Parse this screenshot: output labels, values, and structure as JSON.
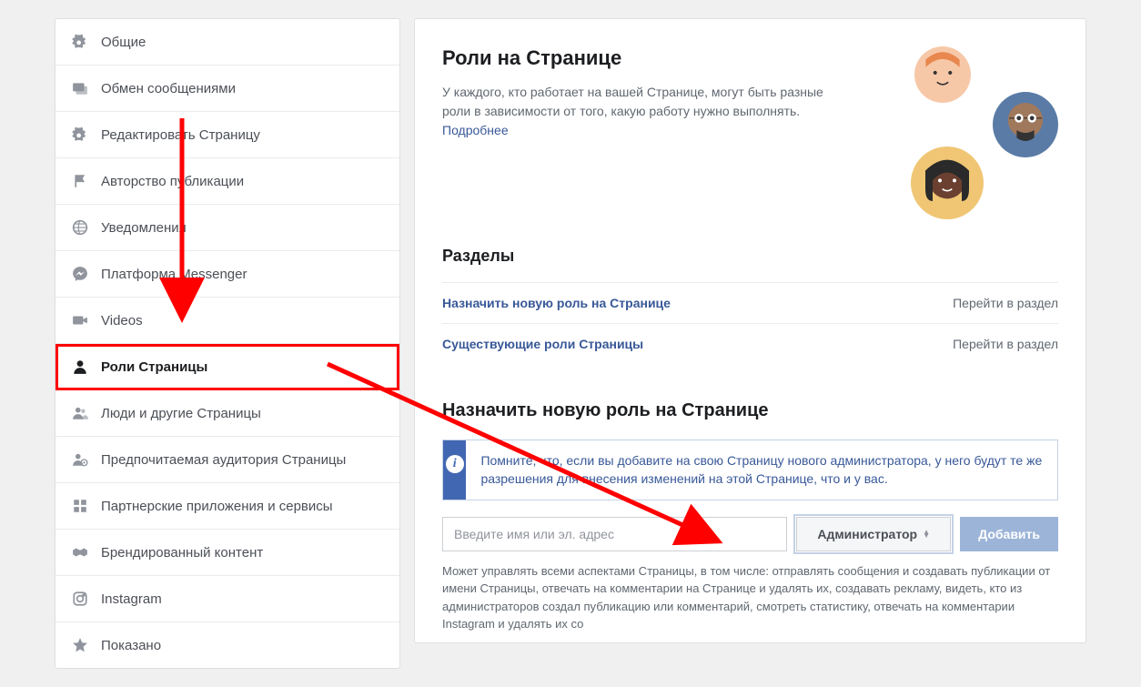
{
  "sidebar": {
    "items": [
      {
        "label": "Общие",
        "icon": "gear"
      },
      {
        "label": "Обмен сообщениями",
        "icon": "messages"
      },
      {
        "label": "Редактировать Страницу",
        "icon": "gear"
      },
      {
        "label": "Авторство публикации",
        "icon": "flag"
      },
      {
        "label": "Уведомления",
        "icon": "globe"
      },
      {
        "label": "Платформа Messenger",
        "icon": "messenger"
      },
      {
        "label": "Videos",
        "icon": "video"
      },
      {
        "label": "Роли Страницы",
        "icon": "person",
        "active": true
      },
      {
        "label": "Люди и другие Страницы",
        "icon": "people"
      },
      {
        "label": "Предпочитаемая аудитория Страницы",
        "icon": "target"
      },
      {
        "label": "Партнерские приложения и сервисы",
        "icon": "grid"
      },
      {
        "label": "Брендированный контент",
        "icon": "handshake"
      },
      {
        "label": "Instagram",
        "icon": "instagram"
      },
      {
        "label": "Показано",
        "icon": "star"
      }
    ]
  },
  "main": {
    "title": "Роли на Странице",
    "desc": "У каждого, кто работает на вашей Странице, могут быть разные роли в зависимости от того, какую работу нужно выполнять. ",
    "learn_more": "Подробнее",
    "sections_title": "Разделы",
    "sections": [
      {
        "name": "Назначить новую роль на Странице",
        "goto": "Перейти в раздел"
      },
      {
        "name": "Существующие роли Страницы",
        "goto": "Перейти в раздел"
      }
    ],
    "assign": {
      "title": "Назначить новую роль на Странице",
      "info": "Помните, что, если вы добавите на свою Страницу нового администратора, у него будут те же разрешения для внесения изменений на этой Странице, что и у вас.",
      "input_placeholder": "Введите имя или эл. адрес",
      "role": "Администратор",
      "add_btn": "Добавить",
      "role_desc": "Может управлять всеми аспектами Страницы, в том числе: отправлять сообщения и создавать публикации от имени Страницы, отвечать на комментарии на Странице и удалять их, создавать рекламу, видеть, кто из администраторов создал публикацию или комментарий, смотреть статистику, отвечать на комментарии Instagram и удалять их со"
    }
  }
}
